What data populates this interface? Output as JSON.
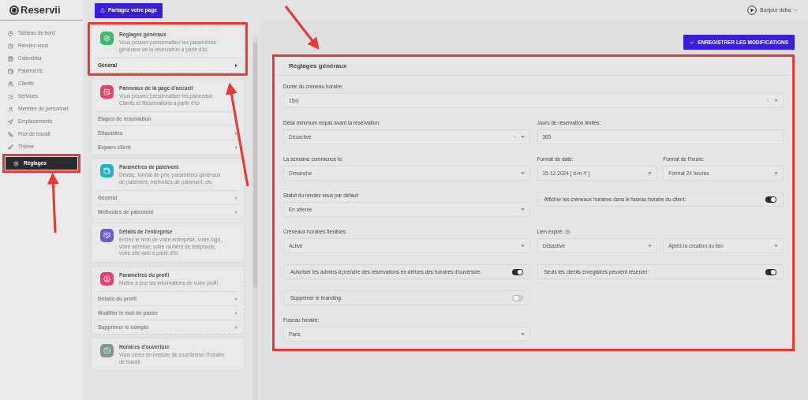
{
  "brand": {
    "name": "Reservii"
  },
  "sidebar": {
    "items": [
      {
        "label": "Tableau de bord",
        "selected": false,
        "highlighted": false
      },
      {
        "label": "Rendez-vous",
        "selected": false,
        "highlighted": false
      },
      {
        "label": "Calendrier",
        "selected": false,
        "highlighted": false
      },
      {
        "label": "Paiements",
        "selected": false,
        "highlighted": false
      },
      {
        "label": "Clients",
        "selected": false,
        "highlighted": false
      },
      {
        "label": "Services",
        "selected": false,
        "highlighted": false
      },
      {
        "label": "Membre du personnel",
        "selected": false,
        "highlighted": false
      },
      {
        "label": "Emplacements",
        "selected": false,
        "highlighted": false
      },
      {
        "label": "Flux de travail",
        "selected": false,
        "highlighted": false
      },
      {
        "label": "Thème",
        "selected": false,
        "highlighted": false
      },
      {
        "label": "Réglages",
        "selected": true,
        "highlighted": true
      }
    ]
  },
  "top_bar": {
    "share_button": "Partagez votre page",
    "user_greeting": "Bonjour deba"
  },
  "settings_cards": [
    {
      "title": "Réglages généraux",
      "description": "Vous pouvez personnaliser les paramètres généraux de la réservation à partir d'ici",
      "color": "#3dba6e",
      "highlighted": true,
      "links": [
        {
          "label": "Général",
          "selected": true
        }
      ]
    },
    {
      "title": "Panneaux de la page d'accueil",
      "description": "Vous pouvez personnaliser les panneaux Clients et Réservations à partir d'ici",
      "color": "#e5436d",
      "highlighted": false,
      "links": [
        {
          "label": "Étapes de réservation",
          "selected": false
        },
        {
          "label": "Étiquettes",
          "selected": false
        },
        {
          "label": "Espace client",
          "selected": false
        }
      ]
    },
    {
      "title": "Paramètres de paiement",
      "description": "Devise, format de prix, paramètres généraux de paiement, méthodes de paiement, etc",
      "color": "#22b2c2",
      "highlighted": false,
      "links": [
        {
          "label": "Général",
          "selected": false
        },
        {
          "label": "Méthodes de paiement",
          "selected": false
        }
      ]
    },
    {
      "title": "Détails de l'entreprise",
      "description": "Entrez le nom de votre entreprise, votre logo, votre adresse, votre numéro de téléphone, votre site web à partir d'ici",
      "color": "#6b5ec6",
      "highlighted": false
    },
    {
      "title": "Paramètres du profil",
      "description": "Mettre à jour les informations de votre profil",
      "color": "#e63f70",
      "highlighted": false,
      "links": [
        {
          "label": "Détails du profil",
          "selected": false
        },
        {
          "label": "Modifier le mot de passe",
          "selected": false
        },
        {
          "label": "Supprimer le compte",
          "selected": false
        }
      ]
    },
    {
      "title": "Horaires d'ouverture",
      "description": "Vous serez en mesure de coordonner l'horaire de travail",
      "color": "#7d9a88",
      "highlighted": false
    }
  ],
  "save_button": "ENREGISTRER LES MODIFICATIONS",
  "panel": {
    "title": "Réglages généraux",
    "highlighted": true,
    "rows": [
      {
        "full": [
          {
            "kind": "select",
            "label": "Durée du créneau horaire:",
            "value": "15m",
            "clearable": true
          }
        ]
      },
      {
        "left": [
          {
            "kind": "select",
            "label": "Délai minimum requis avant la réservation:",
            "value": "Désactivé",
            "clearable": true
          }
        ],
        "right": [
          {
            "kind": "input",
            "label": "Jours de réservation limités:",
            "value": "365"
          }
        ]
      },
      {
        "left": [
          {
            "kind": "select",
            "label": "La semaine commence le:",
            "value": "Dimanche"
          }
        ],
        "right": [
          {
            "kind": "select",
            "label": "Format de date:",
            "value": "15-12-2024 [ d-m-Y ]"
          },
          {
            "kind": "select",
            "label": "Format de l'heure:",
            "value": "Format 24 heures"
          }
        ]
      },
      {
        "left": [
          {
            "kind": "select",
            "label": "Statut du rendez vous par défaut:",
            "value": "En attente"
          }
        ],
        "right": [
          {
            "kind": "toggle",
            "label": "Afficher les créneaux horaires dans le fuseau horaire du client:",
            "on": true
          }
        ]
      },
      {
        "left": [
          {
            "kind": "select",
            "label": "Créneaux horaires flexibles:",
            "value": "Activé"
          }
        ],
        "right": [
          {
            "kind": "select",
            "label": "Lien expiré:",
            "help": true,
            "value": "Désactivé"
          },
          {
            "kind": "select",
            "value": "Après la création du lien"
          }
        ]
      },
      {
        "left": [
          {
            "kind": "toggle",
            "label": "Autoriser les admins à prendre des réservations en dehors des horaires d'ouverture:",
            "on": true
          }
        ],
        "right": [
          {
            "kind": "toggle",
            "label": "Seuls les clients enregistrés peuvent réserver:",
            "on": true
          }
        ]
      },
      {
        "left": [
          {
            "kind": "toggle",
            "label": "Supprimer le branding:",
            "on": false
          }
        ]
      },
      {
        "left": [
          {
            "kind": "select",
            "label": "Fuseau horaire:",
            "value": "Paris"
          }
        ]
      }
    ]
  }
}
